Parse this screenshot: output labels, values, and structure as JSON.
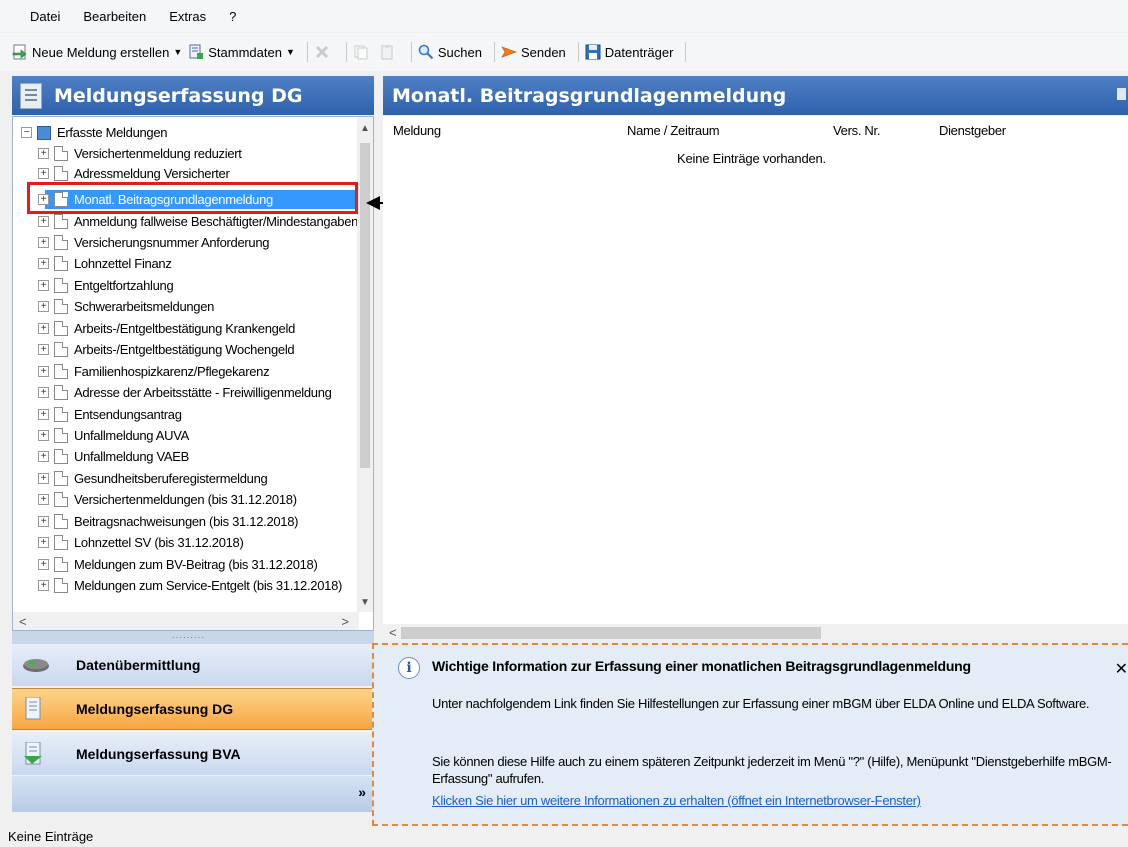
{
  "menu": [
    "Datei",
    "Bearbeiten",
    "Extras",
    "?"
  ],
  "toolbar": {
    "new_report": "Neue Meldung erstellen",
    "master_data": "Stammdaten",
    "search": "Suchen",
    "send": "Senden",
    "media": "Datenträger"
  },
  "left_panel": {
    "title": "Meldungserfassung DG",
    "tree_root": "Erfasste Meldungen",
    "tree_items": [
      "Versichertenmeldung reduziert",
      "Adressmeldung Versicherter",
      "Monatl. Beitragsgrundlagenmeldung",
      "Anmeldung fallweise Beschäftigter/Mindestangabenmeldung",
      "Versicherungsnummer Anforderung",
      "Lohnzettel Finanz",
      "Entgeltfortzahlung",
      "Schwerarbeitsmeldungen",
      "Arbeits-/Entgeltbestätigung Krankengeld",
      "Arbeits-/Entgeltbestätigung Wochengeld",
      "Familienhospizkarenz/Pflegekarenz",
      "Adresse der Arbeitsstätte - Freiwilligenmeldung",
      "Entsendungsantrag",
      "Unfallmeldung AUVA",
      "Unfallmeldung VAEB",
      "Gesundheitsberuferegistermeldung",
      "Versichertenmeldungen (bis 31.12.2018)",
      "Beitragsnachweisungen (bis 31.12.2018)",
      "Lohnzettel SV (bis 31.12.2018)",
      "Meldungen zum BV-Beitrag (bis 31.12.2018)",
      "Meldungen zum Service-Entgelt (bis 31.12.2018)"
    ],
    "selected_index": 2
  },
  "nav": {
    "transmission": "Datenübermittlung",
    "dg": "Meldungserfassung DG",
    "bva": "Meldungserfassung BVA"
  },
  "right_panel": {
    "title": "Monatl. Beitragsgrundlagenmeldung",
    "columns": [
      "Meldung",
      "Name / Zeitraum",
      "Vers. Nr.",
      "Dienstgeber"
    ],
    "empty_text": "Keine Einträge vorhanden."
  },
  "info": {
    "title": "Wichtige Information zur Erfassung einer monatlichen Beitragsgrundlagenmeldung",
    "p1": "Unter nachfolgendem Link finden Sie Hilfestellungen zur Erfassung einer mBGM über ELDA Online und ELDA Software.",
    "p2": "Sie können diese Hilfe auch zu einem späteren Zeitpunkt jederzeit im Menü \"?\" (Hilfe), Menüpunkt \"Dienstgeberhilfe mBGM-Erfassung\" aufrufen.",
    "link": "Klicken Sie hier um weitere Informationen zu erhalten (öffnet ein Internetbrowser-Fenster)"
  },
  "status": "Keine Einträge",
  "icons": {
    "new_report": "new-document-icon",
    "master_data": "master-data-icon",
    "delete": "delete-icon",
    "search": "magnifier-icon",
    "send": "send-icon",
    "save": "floppy-disk-icon"
  }
}
